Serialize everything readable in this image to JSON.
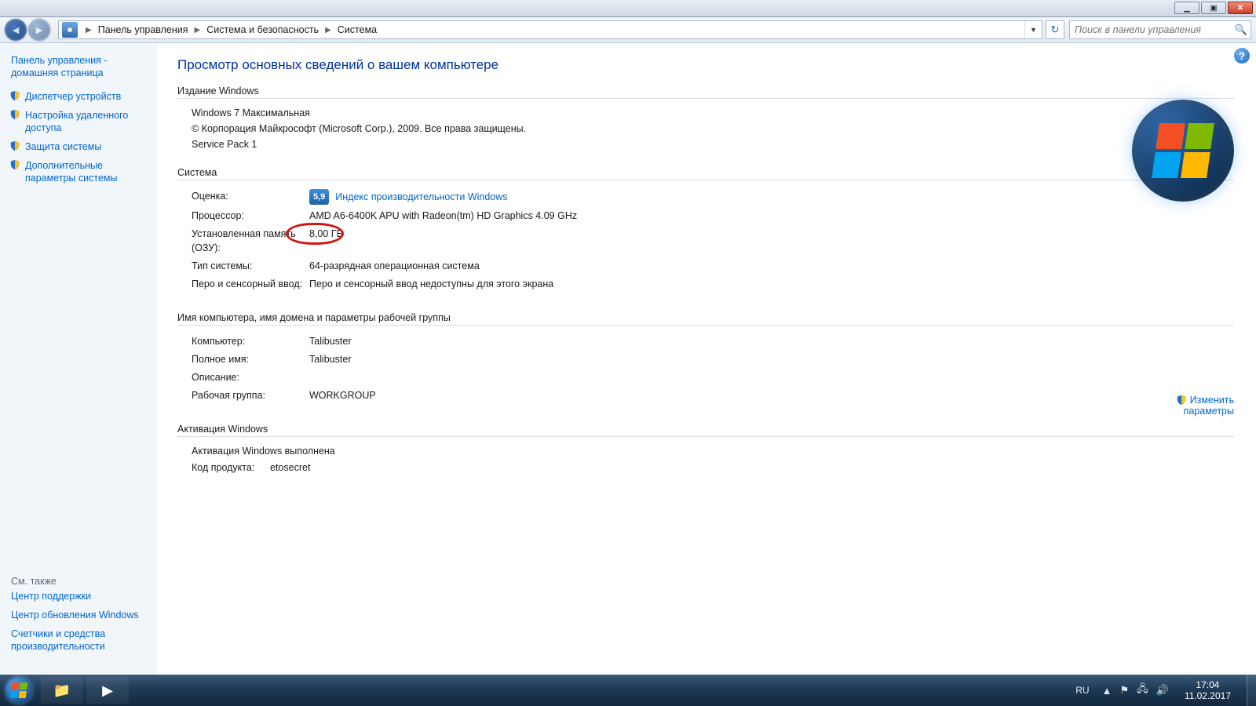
{
  "window": {
    "min": "▁",
    "max": "▣",
    "close": "✕"
  },
  "breadcrumb": {
    "root": "Панель управления",
    "mid": "Система и безопасность",
    "leaf": "Система"
  },
  "search": {
    "placeholder": "Поиск в панели управления"
  },
  "sidebar": {
    "home": "Панель управления - домашняя страница",
    "links": [
      "Диспетчер устройств",
      "Настройка удаленного доступа",
      "Защита системы",
      "Дополнительные параметры системы"
    ],
    "seealso_head": "См. также",
    "seealso": [
      "Центр поддержки",
      "Центр обновления Windows",
      "Счетчики и средства производительности"
    ]
  },
  "main": {
    "title": "Просмотр основных сведений о вашем компьютере",
    "sec_edition": "Издание Windows",
    "edition_name": "Windows 7 Максимальная",
    "copyright": "© Корпорация Майкрософт (Microsoft Corp.), 2009. Все права защищены.",
    "sp": "Service Pack 1",
    "sec_system": "Система",
    "rating_label": "Оценка:",
    "rating_score": "5,9",
    "rating_link": "Индекс производительности Windows",
    "cpu_label": "Процессор:",
    "cpu_value": "AMD A6-6400K APU with Radeon(tm) HD Graphics     4.09 GHz",
    "ram_label": "Установленная память (ОЗУ):",
    "ram_value": "8,00 ГБ",
    "type_label": "Тип системы:",
    "type_value": "64-разрядная операционная система",
    "pen_label": "Перо и сенсорный ввод:",
    "pen_value": "Перо и сенсорный ввод недоступны для этого экрана",
    "sec_name": "Имя компьютера, имя домена и параметры рабочей группы",
    "comp_label": "Компьютер:",
    "comp_value": "Talibuster",
    "full_label": "Полное имя:",
    "full_value": "Talibuster",
    "desc_label": "Описание:",
    "desc_value": "",
    "wg_label": "Рабочая группа:",
    "wg_value": "WORKGROUP",
    "change_link": "Изменить",
    "change_sub": "параметры",
    "sec_act": "Активация Windows",
    "act_status": "Активация Windows выполнена",
    "pk_label": "Код продукта:",
    "pk_value": "etosecret"
  },
  "taskbar": {
    "lang": "RU",
    "time": "17:04",
    "date": "11.02.2017"
  }
}
